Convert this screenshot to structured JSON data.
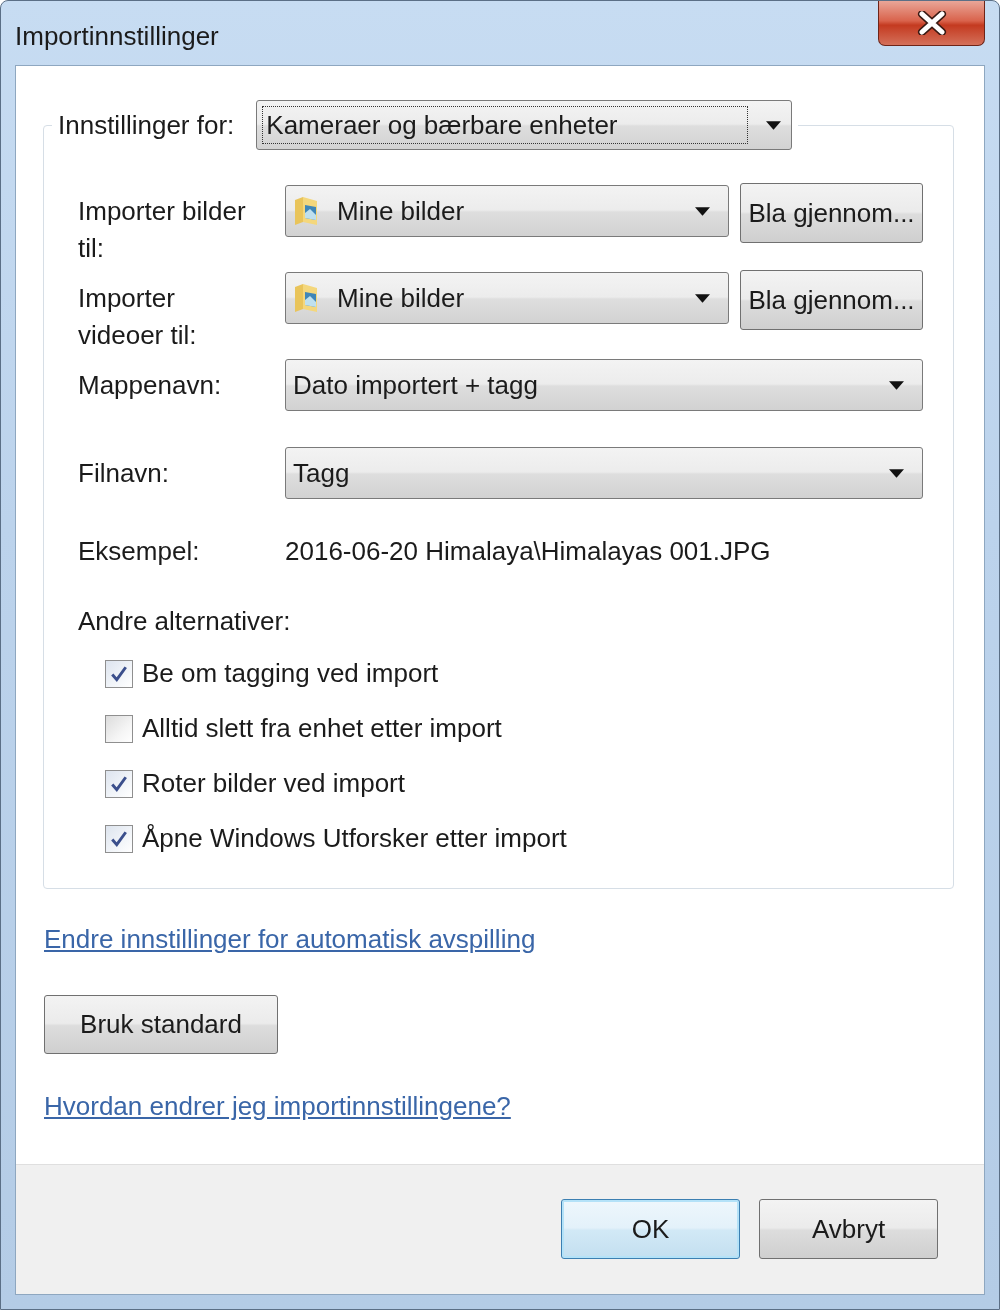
{
  "window": {
    "title": "Importinnstillinger"
  },
  "settings_for": {
    "label": "Innstillinger for:",
    "value": "Kameraer og bærbare enheter",
    "focused": true
  },
  "fields": [
    {
      "kind": "folder",
      "label": "Importer bilder til:",
      "value": "Mine bilder",
      "button": "Bla gjennom..."
    },
    {
      "kind": "folder",
      "label": "Importer videoer til:",
      "value": "Mine bilder",
      "button": "Bla gjennom..."
    },
    {
      "kind": "select",
      "label": "Mappenavn:",
      "value": "Dato importert + tagg"
    },
    {
      "kind": "select",
      "label": "Filnavn:",
      "value": "Tagg"
    },
    {
      "kind": "text",
      "label": "Eksempel:",
      "value": "2016-06-20 Himalaya\\Himalayas 001.JPG"
    }
  ],
  "other_options": {
    "label": "Andre alternativer:",
    "options": [
      {
        "label": "Be om tagging ved import",
        "checked": true
      },
      {
        "label": "Alltid slett fra enhet etter import",
        "checked": false
      },
      {
        "label": "Roter bilder ved import",
        "checked": true
      },
      {
        "label": "Åpne Windows Utforsker etter import",
        "checked": true
      }
    ]
  },
  "autoplay_link": "Endre innstillinger for automatisk avspilling",
  "restore_button": "Bruk standard",
  "help_link": "Hvordan endrer jeg importinnstillingene?",
  "footer": {
    "buttons": [
      {
        "label": "OK",
        "default": true
      },
      {
        "label": "Avbryt",
        "default": false
      }
    ]
  }
}
